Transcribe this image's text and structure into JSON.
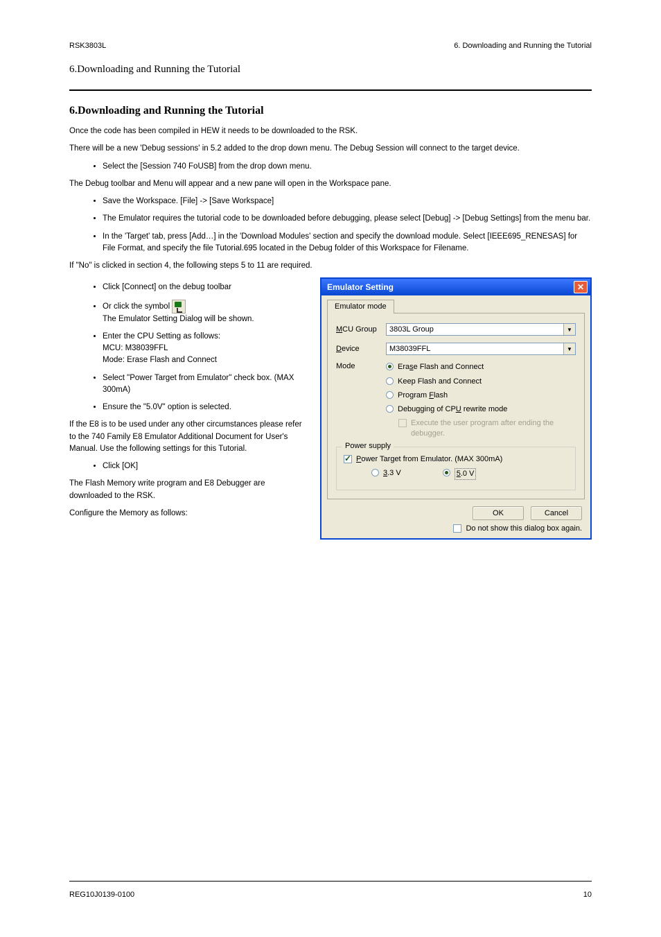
{
  "header": {
    "left": "RSK3803L",
    "right": "6. Downloading and Running the Tutorial"
  },
  "page_title": "6.Downloading and Running the Tutorial",
  "intro": "Once the code has been compiled in HEW it needs to be downloaded to the RSK.",
  "intro2_part1": "There will be a new ",
  "intro2_target": "'Debug sessions'",
  "intro2_part2": " in 5.2 added to the drop down menu. The Debug Session will connect to the target device.",
  "steps": {
    "s1": "Select the [Session 740 FoUSB] from the drop down menu.",
    "note_after_s1": "The Debug toolbar and Menu will appear and a new pane will open in the Workspace pane.",
    "s2": "Save the Workspace. [File] -> [Save Workspace]",
    "s3": "The Emulator requires the tutorial code to be downloaded before debugging, please select [Debug] -> [Debug Settings]  from the menu bar.",
    "s4_part1": "In the ",
    "s4_target": "'Target'",
    "s4_part2": " tab, press [Add…] in the ",
    "s4_modules": "'Download Modules'",
    "s4_part3": " section and specify the download module. Select [IEEE695_RENESAS] for File Format, and specify the file Tutorial.695 located in the Debug folder of this Workspace for Filename.",
    "note_after_s4": " If \"No\" is clicked in section 4, the following steps 5 to 11 are required."
  },
  "narrow": {
    "s5_pre": "Click [Connect] on the debug toolbar ",
    "s5_post": "",
    "or_start": "Or click the symbol ",
    "or_line2": "    The Emulator Setting Dialog will be shown.",
    "s6_p1": "Enter the CPU Setting as follows:",
    "s6_p2": "MCU: M38039FFL",
    "s6_p3": "Mode: Erase Flash and Connect",
    "s7": "Select \"Power Target from Emulator\" check box. (MAX 300mA)",
    "s8": "Ensure the \"5.0V\" option is selected.",
    "warn": "If the E8 is to be used under any other circumstances please refer to the 740 Family E8 Emulator Additional Document for User's Manual. Use the following settings for this Tutorial.",
    "s9": "Click [OK]",
    "post1": "The Flash Memory write program and E8 Debugger are downloaded to the RSK.",
    "post2": "Configure the Memory as follows:"
  },
  "dialog": {
    "title": "Emulator Setting",
    "tab": "Emulator mode",
    "mcu_label": "MCU Group",
    "mcu_value": "3803L Group",
    "device_label": "Device",
    "device_value": "M38039FFL",
    "mode_label": "Mode",
    "mode_opts": {
      "erase": "Erase Flash and Connect",
      "keep": "Keep Flash and Connect",
      "program": "Program Flash",
      "debug_cpu": "Debugging of CPU rewrite mode",
      "execute_after": "Execute the user program after ending the debugger."
    },
    "ps_legend": "Power supply",
    "ps_chk": "Power Target from Emulator. (MAX 300mA)",
    "v33": "3.3 V",
    "v50": "5.0 V",
    "ok": "OK",
    "cancel": "Cancel",
    "dont_show": "Do not show this dialog box again."
  },
  "footer": {
    "left": "REG10J0139-0100",
    "right": "10"
  }
}
